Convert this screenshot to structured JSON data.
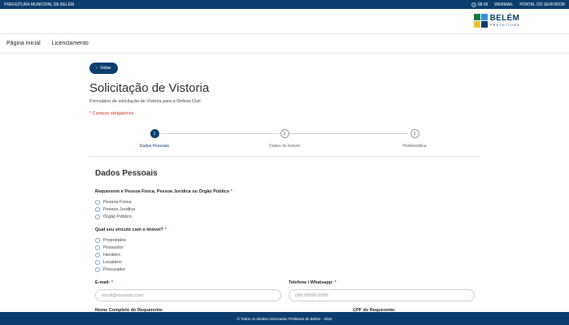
{
  "top_bar": {
    "left_text": "PREFEITURA MUNICIPAL DE BELÉM",
    "time": "08:09",
    "links": [
      "WEBMAIL",
      "PORTAL DO SERVIDOR"
    ]
  },
  "logo": {
    "title": "BELÉM",
    "subtitle": "PREFEITURA"
  },
  "nav": {
    "items": [
      "Página Inicial",
      "Licenciamento"
    ]
  },
  "back_button": {
    "label": "Voltar"
  },
  "page": {
    "title": "Solicitação de Vistoria",
    "subtitle": "Formulário de solicitação de Vistoria para a Defesa Civil",
    "required_note": "* Campos obrigatórios."
  },
  "stepper": {
    "active_index": 0,
    "steps": [
      {
        "number": "1",
        "label": "Dados Pessoais"
      },
      {
        "number": "2",
        "label": "Dados do Imóvel"
      },
      {
        "number": "3",
        "label": "Problemática"
      }
    ]
  },
  "section": {
    "title": "Dados Pessoais"
  },
  "q_requerente": {
    "label": "Requerente é Pessoa Física, Pessoa Jurídica ou Órgão Público",
    "required_mark": "*",
    "options": [
      "Pessoa Física",
      "Pessoa Jurídica",
      "Órgão Público"
    ]
  },
  "q_vinculo": {
    "label": "Qual seu vínculo com o imóvel?",
    "required_mark": "*",
    "options": [
      "Proprietário",
      "Possuidor",
      "Herdeiro",
      "Locatário",
      "Procurador"
    ]
  },
  "email": {
    "label": "E-mail:",
    "required_mark": "*",
    "placeholder": "email@exemplo.com",
    "value": ""
  },
  "telefone": {
    "label": "Telefone / Whatsapp:",
    "required_mark": "*",
    "placeholder": "(99) 99999-9999",
    "value": ""
  },
  "cut_off": {
    "left": "Nome Completo do Requerente:",
    "right": "CPF do Requerente:"
  },
  "footer": {
    "text": "© Todos os direitos reservados Prefeitura de Belém - 2025"
  },
  "colors": {
    "brand": "#0b3d6e",
    "required": "#c0392b"
  }
}
